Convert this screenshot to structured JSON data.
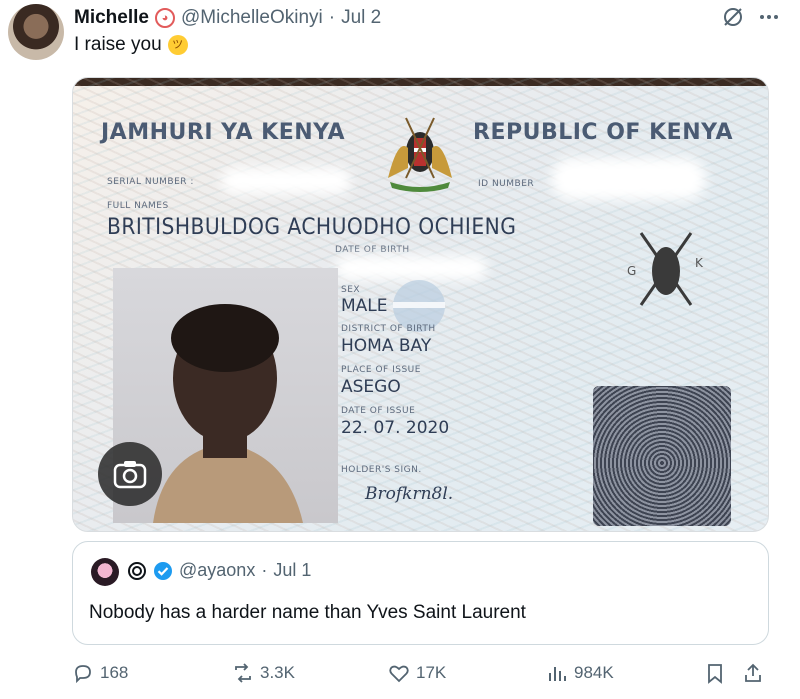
{
  "tweet": {
    "author_name": "Michelle",
    "author_emoji": "clown-face",
    "handle": "@MichelleOkinyi",
    "separator": "·",
    "date": "Jul 2",
    "text": "I raise you",
    "text_emoji": "zany-face"
  },
  "id_card": {
    "left_title": "JAMHURI YA KENYA",
    "right_title": "REPUBLIC OF KENYA",
    "serial_label": "SERIAL NUMBER :",
    "id_label": "ID NUMBER",
    "full_names_label": "FULL NAMES",
    "full_name": "BRITISHBULDOG ACHUODHO OCHIENG",
    "dob_label": "DATE OF BIRTH",
    "sex_label": "SEX",
    "sex": "MALE",
    "district_label": "DISTRICT OF BIRTH",
    "district": "HOMA BAY",
    "place_label": "PLACE OF ISSUE",
    "place": "ASEGO",
    "issue_date_label": "DATE OF ISSUE",
    "issue_date": "22. 07. 2020",
    "sign_label": "HOLDER'S SIGN.",
    "signature": "Brofkrn8l.",
    "emblem_left": "G",
    "emblem_right": "K"
  },
  "quoted": {
    "handle": "@ayaonx",
    "separator": "·",
    "date": "Jul 1",
    "text": "Nobody has a harder name than Yves Saint Laurent"
  },
  "actions": {
    "replies": "168",
    "reposts": "3.3K",
    "likes": "17K",
    "views": "984K"
  },
  "colors": {
    "text": "#0f1419",
    "muted": "#536471",
    "verified": "#1d9bf0",
    "border": "#cfd9de"
  }
}
